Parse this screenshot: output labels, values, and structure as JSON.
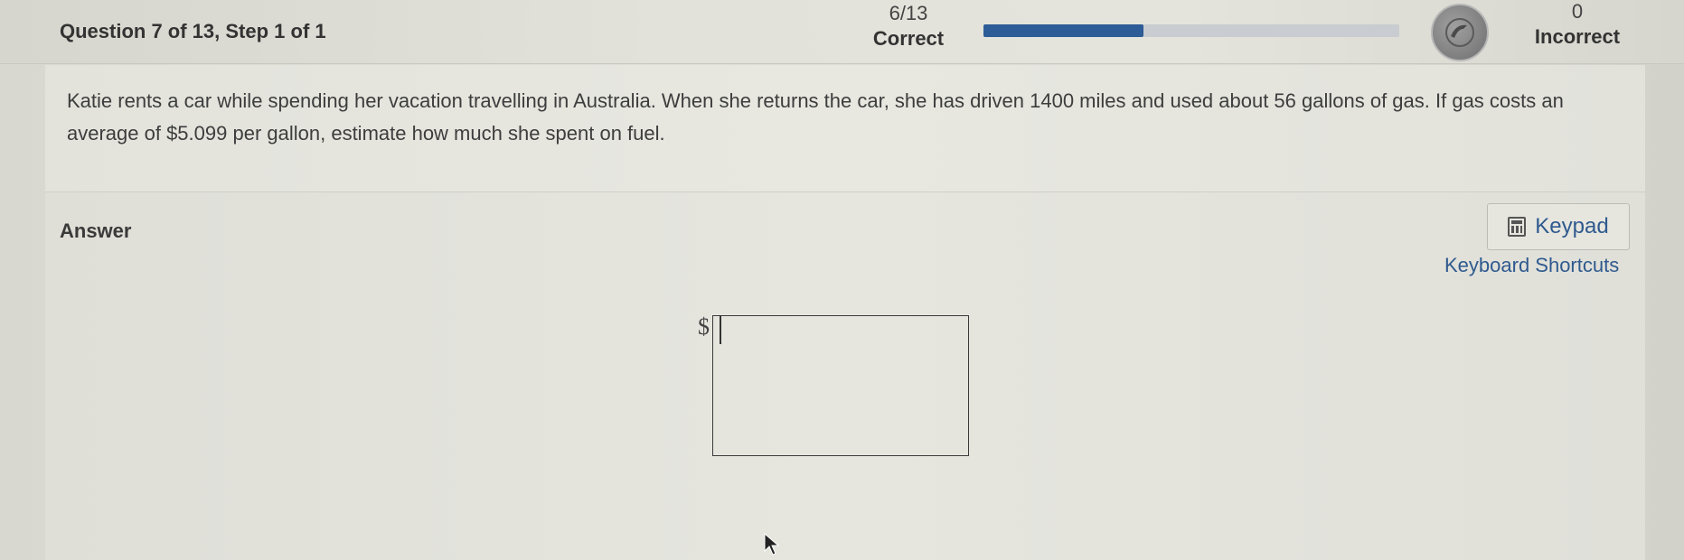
{
  "header": {
    "question_title": "Question 7 of 13, Step 1 of 1",
    "correct_count": "6/13",
    "correct_label": "Correct",
    "progress_fraction": 0.385,
    "incorrect_count": "0",
    "incorrect_label": "Incorrect",
    "badge_icon": "streak-badge-icon"
  },
  "question": {
    "text": "Katie rents a car while spending her vacation travelling in Australia. When she returns the car, she has driven 1400 miles and used about 56 gallons of gas. If gas costs an average of $5.099 per gallon, estimate how much she spent on fuel."
  },
  "answer": {
    "label": "Answer",
    "keypad_label": "Keypad",
    "keypad_icon": "calculator-icon",
    "shortcuts_label": "Keyboard Shortcuts",
    "prefix": "$",
    "value": ""
  },
  "colors": {
    "accent": "#2d5c96",
    "link": "#2f5a8e"
  }
}
